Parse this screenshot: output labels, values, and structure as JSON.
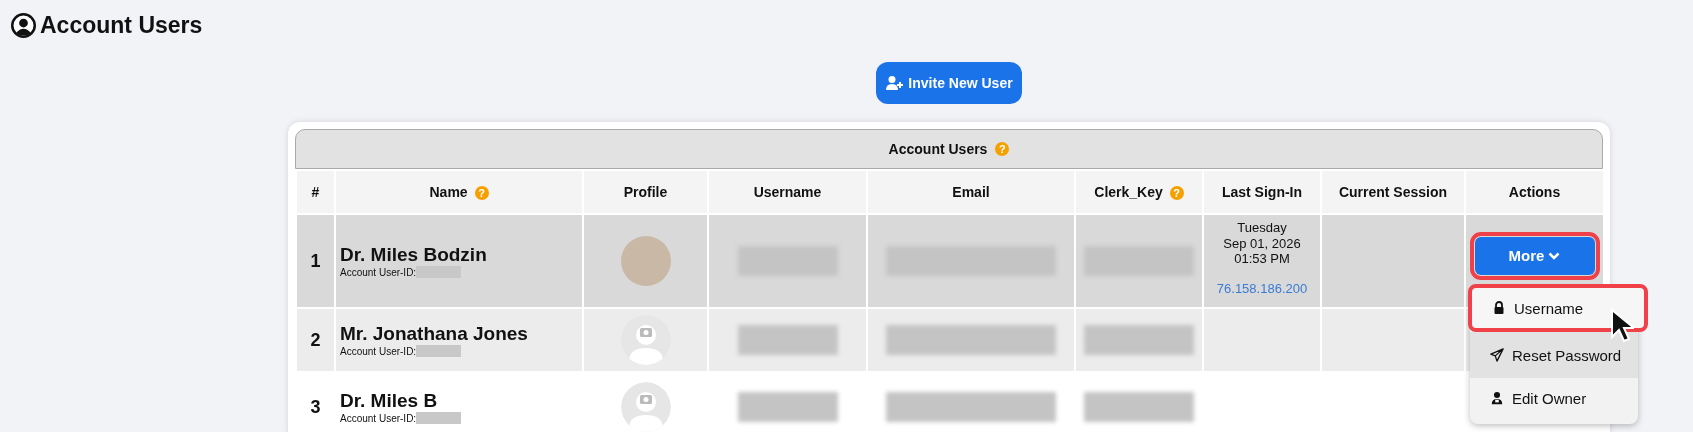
{
  "page_title": "Account Users",
  "invite_button": "Invite New User",
  "table": {
    "title": "Account Users",
    "title_help": "?",
    "columns": [
      {
        "label": "#"
      },
      {
        "label": "Name",
        "help": "?"
      },
      {
        "label": "Profile"
      },
      {
        "label": "Username"
      },
      {
        "label": "Email"
      },
      {
        "label": "Clerk_Key",
        "help": "?"
      },
      {
        "label": "Last Sign-In"
      },
      {
        "label": "Current Session"
      },
      {
        "label": "Actions"
      }
    ],
    "rows": [
      {
        "index": "1",
        "name": "Dr. Miles Bodzin",
        "user_id_label": "Account User-ID:",
        "selected": true,
        "has_photo": true,
        "user_id_hidden": true,
        "username_hidden": true,
        "email_hidden": true,
        "clerk_key_hidden": true,
        "last_sign_in": [
          "Tuesday",
          "Sep 01, 2026",
          "01:53 PM"
        ],
        "ip": "76.158.186.200",
        "action": {
          "label": "More",
          "highlighted": true
        }
      },
      {
        "index": "2",
        "name": "Mr. Jonathana Jones",
        "user_id_label": "Account User-ID:",
        "selected": false,
        "has_photo": false,
        "user_id_hidden": true,
        "username_hidden": true,
        "email_hidden": true,
        "clerk_key_hidden": true
      },
      {
        "index": "3",
        "name": "Dr. Miles B",
        "user_id_label": "Account User-ID:",
        "selected": false,
        "has_photo": false,
        "user_id_hidden": true,
        "username_hidden": true,
        "email_hidden": true,
        "clerk_key_hidden": true
      }
    ]
  },
  "dropdown_menu": [
    {
      "kind": "lock",
      "label": "Username",
      "highlighted": true
    },
    {
      "kind": "send",
      "label": "Reset Password",
      "highlighted": false
    },
    {
      "kind": "owner",
      "label": "Edit Owner",
      "highlighted": false
    }
  ]
}
